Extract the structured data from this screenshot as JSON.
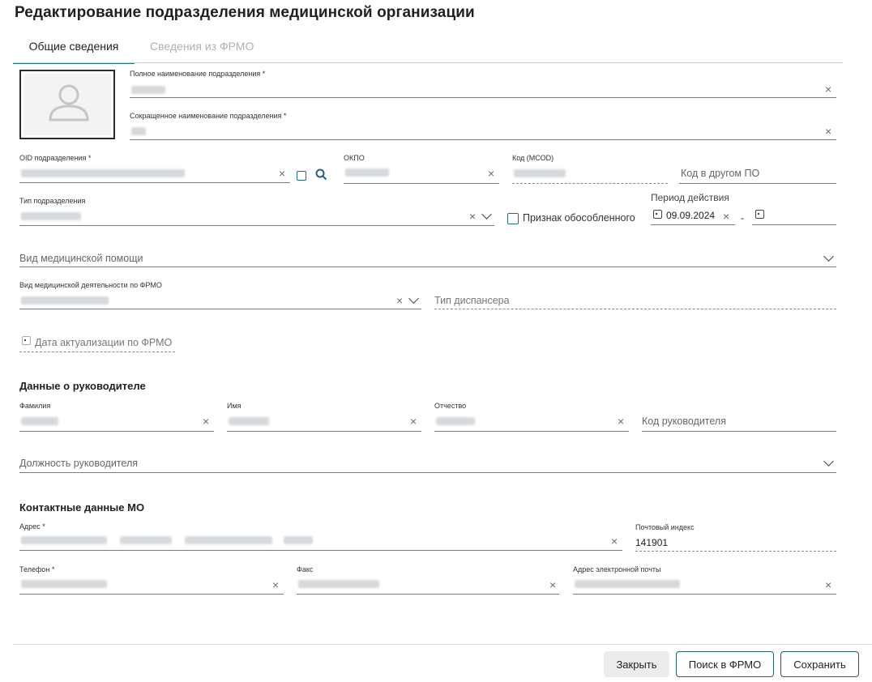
{
  "page": {
    "title": "Редактирование подразделения медицинской организации",
    "tabs": [
      {
        "label": "Общие сведения",
        "active": true
      },
      {
        "label": "Сведения из ФРМО",
        "active": false
      }
    ]
  },
  "form": {
    "full_name_label": "Полное наименование подразделения *",
    "short_name_label": "Сокращенное наименование подразделения *",
    "oid_label": "OID подразделения *",
    "okpo_label": "ОКПО",
    "mcod_label": "Код (МСОD)",
    "other_code_placeholder": "Код в другом ПО",
    "unit_type_label": "Тип подразделения",
    "separate_label": "Признак обособленного",
    "period_label": "Период действия",
    "period_start": "09.09.2024",
    "period_dash": "-",
    "care_type_placeholder": "Вид медицинской помощи",
    "activity_label": "Вид медицинской деятельности по ФРМО",
    "dispensary_placeholder": "Тип диспансера",
    "actualization_placeholder": "Дата актуализации по ФРМО"
  },
  "head": {
    "section_title": "Данные о руководителе",
    "surname_label": "Фамилия",
    "name_label": "Имя",
    "patronymic_label": "Отчество",
    "code_placeholder": "Код руководителя",
    "position_placeholder": "Должность руководителя"
  },
  "contacts": {
    "section_title": "Контактные данные МО",
    "address_label": "Адрес *",
    "postcode_label": "Почтовый индекс",
    "postcode_value": "141901",
    "phone_label": "Телефон *",
    "fax_label": "Факс",
    "email_label": "Адрес электронной почты"
  },
  "footer": {
    "close_label": "Закрыть",
    "search_frmo_label": "Поиск в ФРМО",
    "save_label": "Сохранить"
  },
  "icons": {
    "clear": "×",
    "search": "search-icon",
    "calendar": "calendar-icon",
    "chevron": "chevron-down-icon"
  },
  "colors": {
    "accent": "#1f7a7a",
    "button_border": "#1f5f6e",
    "blurred_value": "#d6dadd"
  }
}
